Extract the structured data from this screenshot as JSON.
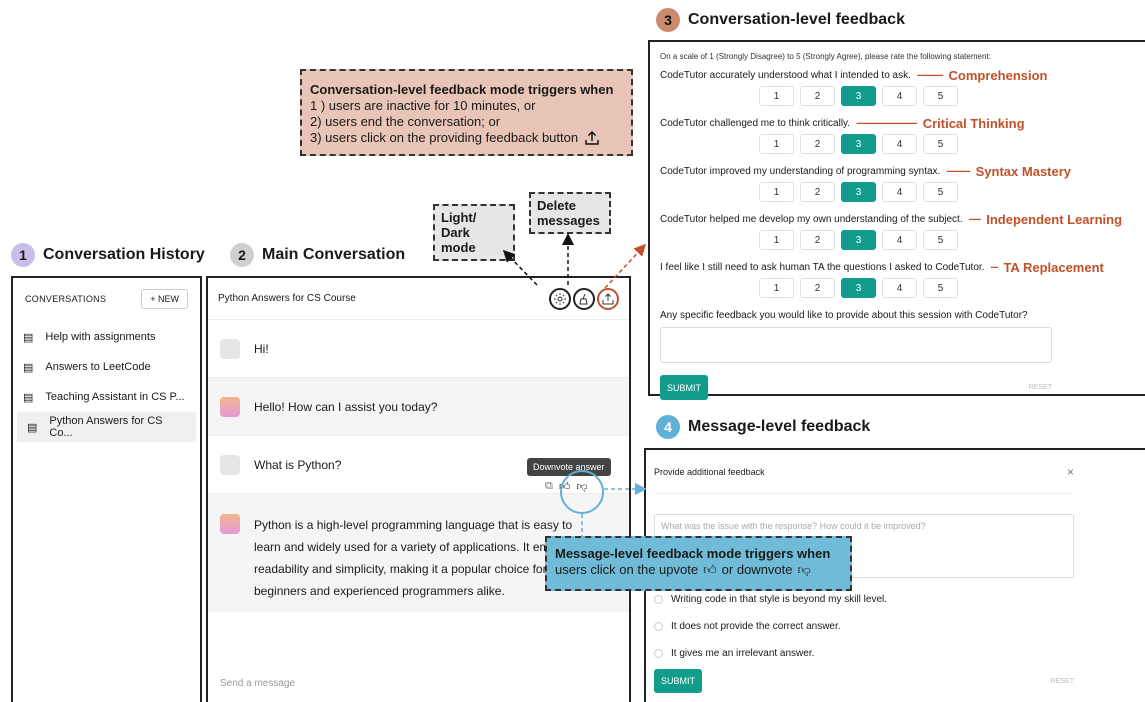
{
  "sections": {
    "history": {
      "num": "1",
      "title": "Conversation History",
      "color": "#c9bfea"
    },
    "main": {
      "num": "2",
      "title": "Main Conversation",
      "color": "#cfcfcf"
    },
    "conv_feedback": {
      "num": "3",
      "title": "Conversation-level feedback",
      "color": "#c98a6e"
    },
    "msg_feedback": {
      "num": "4",
      "title": "Message-level feedback",
      "color": "#5fb1d6"
    }
  },
  "trigger_note": {
    "title": "Conversation-level feedback mode triggers when",
    "line1": "1 ) users are inactive for 10 minutes, or",
    "line2": "2) users end the conversation; or",
    "line3": "3) users click on the providing feedback button"
  },
  "callouts": {
    "light_dark": "Light/ Dark mode",
    "delete": "Delete messages"
  },
  "sidebar": {
    "header": "CONVERSATIONS",
    "new_button": "+ NEW",
    "items": [
      {
        "label": "Help with assignments"
      },
      {
        "label": "Answers to LeetCode"
      },
      {
        "label": "Teaching Assistant in CS P..."
      },
      {
        "label": "Python Answers for CS Co..."
      }
    ]
  },
  "chat": {
    "title": "Python Answers for CS Course",
    "messages": [
      {
        "role": "user",
        "text": "Hi!"
      },
      {
        "role": "assistant",
        "text": "Hello! How can I assist you today?"
      },
      {
        "role": "user",
        "text": "What is Python?"
      },
      {
        "role": "assistant",
        "line1": "Python is a high-level programming language that is easy to",
        "line2": "learn and widely used for a variety of applications. It emphasizes",
        "line3": "readability and simplicity, making it a popular choice for",
        "line4": "beginners and experienced programmers alike."
      }
    ],
    "tooltip": "Downvote answer",
    "input_placeholder": "Send a message"
  },
  "survey": {
    "intro": "On a scale of 1 (Strongly Disagree) to 5 (Strongly Agree), please rate the following statement:",
    "scale": [
      "1",
      "2",
      "3",
      "4",
      "5"
    ],
    "selected": "3",
    "questions": [
      {
        "text": "CodeTutor accurately understood what I intended to ask.",
        "dashes": "-----------",
        "label": "Comprehension"
      },
      {
        "text": "CodeTutor challenged me to think critically.",
        "dashes": "--------------------------",
        "label": "Critical Thinking"
      },
      {
        "text": "CodeTutor improved my understanding of programming syntax.",
        "dashes": "----------",
        "label": "Syntax Mastery"
      },
      {
        "text": "CodeTutor helped me develop my own understanding of the subject.",
        "dashes": "-----",
        "label": "Independent Learning"
      },
      {
        "text": "I feel like I still need to ask human TA the questions I asked to CodeTutor.",
        "dashes": "---",
        "label": "TA Replacement"
      }
    ],
    "open_question": "Any specific feedback you would like to provide about this session with CodeTutor?",
    "submit": "SUBMIT",
    "reset": "RESET"
  },
  "msg_dialog": {
    "title": "Provide additional feedback",
    "close": "×",
    "placeholder": "What was the issue with the response? How could it be improved?",
    "options": [
      "Writing code in that style is beyond my skill level.",
      "It does not provide the correct answer.",
      "It gives me an irrelevant answer."
    ],
    "submit": "SUBMIT",
    "reset": "RESET"
  },
  "msg_note": {
    "title": "Message-level feedback mode triggers when",
    "line": "users click on the upvote",
    "or": "or downvote"
  },
  "colors": {
    "accent_teal": "#129c8c",
    "trigger_bg": "#e8c5b6",
    "blue_note": "#70bcd8",
    "orange": "#c0512a"
  }
}
